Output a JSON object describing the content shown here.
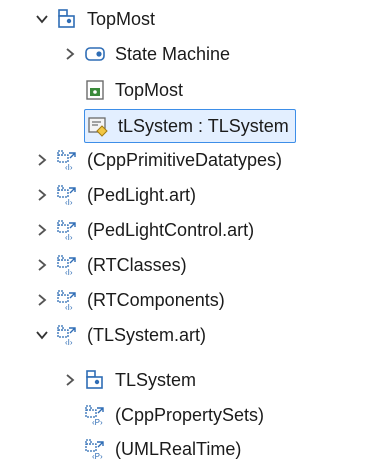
{
  "tree": {
    "items": [
      {
        "label": "TopMost",
        "icon": "package-icon",
        "expanded": true,
        "level": 1
      },
      {
        "label": "State Machine",
        "icon": "state-machine-icon",
        "expanded": false,
        "level": 2
      },
      {
        "label": "TopMost",
        "icon": "diagram-icon",
        "level": 2
      },
      {
        "label": "tLSystem : TLSystem",
        "icon": "part-icon",
        "level": 2,
        "selected": true
      },
      {
        "label": "(CppPrimitiveDatatypes)",
        "icon": "imported-package-icon",
        "expanded": false,
        "level": 0
      },
      {
        "label": "(PedLight.art)",
        "icon": "imported-package-icon",
        "expanded": false,
        "level": 0
      },
      {
        "label": "(PedLightControl.art)",
        "icon": "imported-package-icon",
        "expanded": false,
        "level": 0
      },
      {
        "label": "(RTClasses)",
        "icon": "imported-package-icon",
        "expanded": false,
        "level": 0
      },
      {
        "label": "(RTComponents)",
        "icon": "imported-package-icon",
        "expanded": false,
        "level": 0
      },
      {
        "label": "(TLSystem.art)",
        "icon": "imported-package-icon",
        "expanded": true,
        "level": 0
      },
      {
        "label": "TLSystem",
        "icon": "package-icon",
        "expanded": false,
        "level": 1
      },
      {
        "label": "(CppPropertySets)",
        "icon": "applied-profile-icon",
        "level": 1
      },
      {
        "label": "(UMLRealTime)",
        "icon": "applied-profile-icon",
        "level": 1
      }
    ]
  },
  "colors": {
    "selection_border": "#3d8ee8",
    "selection_fill": "#e3efff",
    "package_blue": "#2f6db5",
    "diagram_green": "#3a8a3a"
  }
}
